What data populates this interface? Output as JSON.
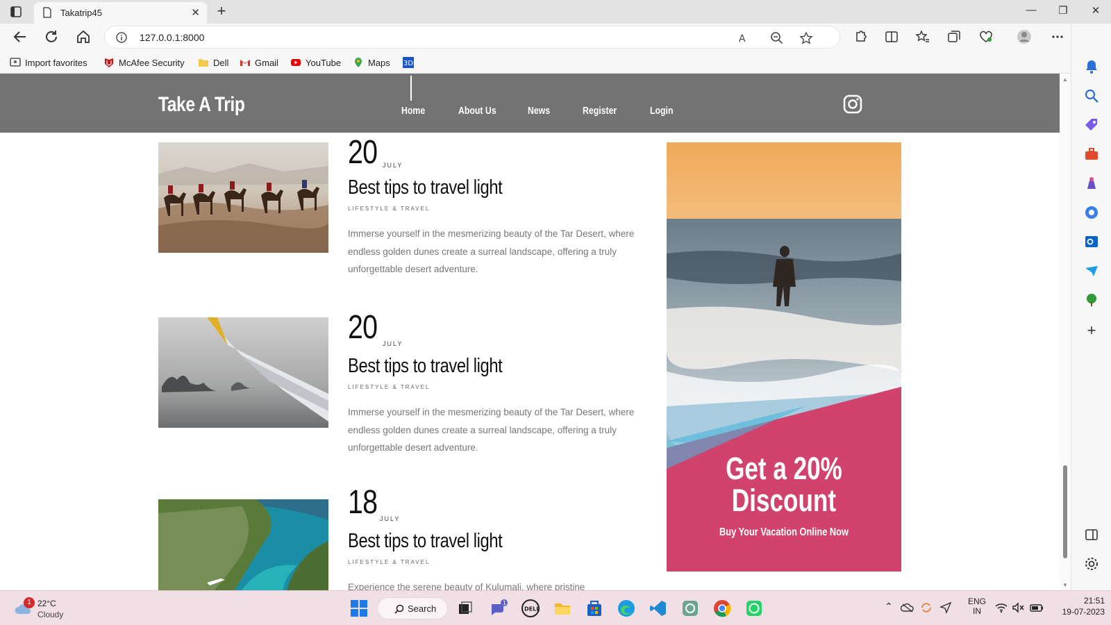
{
  "browser": {
    "tab_title": "Takatrip45",
    "url": "127.0.0.1:8000",
    "bookmarks": [
      "Import favorites",
      "McAfee Security",
      "Dell",
      "Gmail",
      "YouTube",
      "Maps"
    ]
  },
  "site": {
    "logo": "Take A Trip",
    "nav": [
      "Home",
      "About Us",
      "News",
      "Register",
      "Login"
    ],
    "posts": [
      {
        "day": "20",
        "month": "JULY",
        "title": "Best tips to travel light",
        "category": "LIFESTYLE & TRAVEL",
        "excerpt": "Immerse yourself in the mesmerizing beauty of the Tar Desert, where endless golden dunes create a surreal landscape, offering a truly unforgettable desert adventure."
      },
      {
        "day": "20",
        "month": "JULY",
        "title": "Best tips to travel light",
        "category": "LIFESTYLE & TRAVEL",
        "excerpt": "Immerse yourself in the mesmerizing beauty of the Tar Desert, where endless golden dunes create a surreal landscape, offering a truly unforgettable desert adventure."
      },
      {
        "day": "18",
        "month": "JULY",
        "title": "Best tips to travel light",
        "category": "LIFESTYLE & TRAVEL",
        "excerpt": "Experience the serene beauty of Kulumali, where pristine"
      }
    ],
    "ad": {
      "line1": "Get a 20%",
      "line2": "Discount",
      "subtitle": "Buy Your Vacation Online Now"
    }
  },
  "taskbar": {
    "weather_temp": "22°C",
    "weather_desc": "Cloudy",
    "weather_badge": "1",
    "search": "Search",
    "chat_badge": "1",
    "lang1": "ENG",
    "lang2": "IN",
    "time": "21:51",
    "date": "19-07-2023"
  }
}
